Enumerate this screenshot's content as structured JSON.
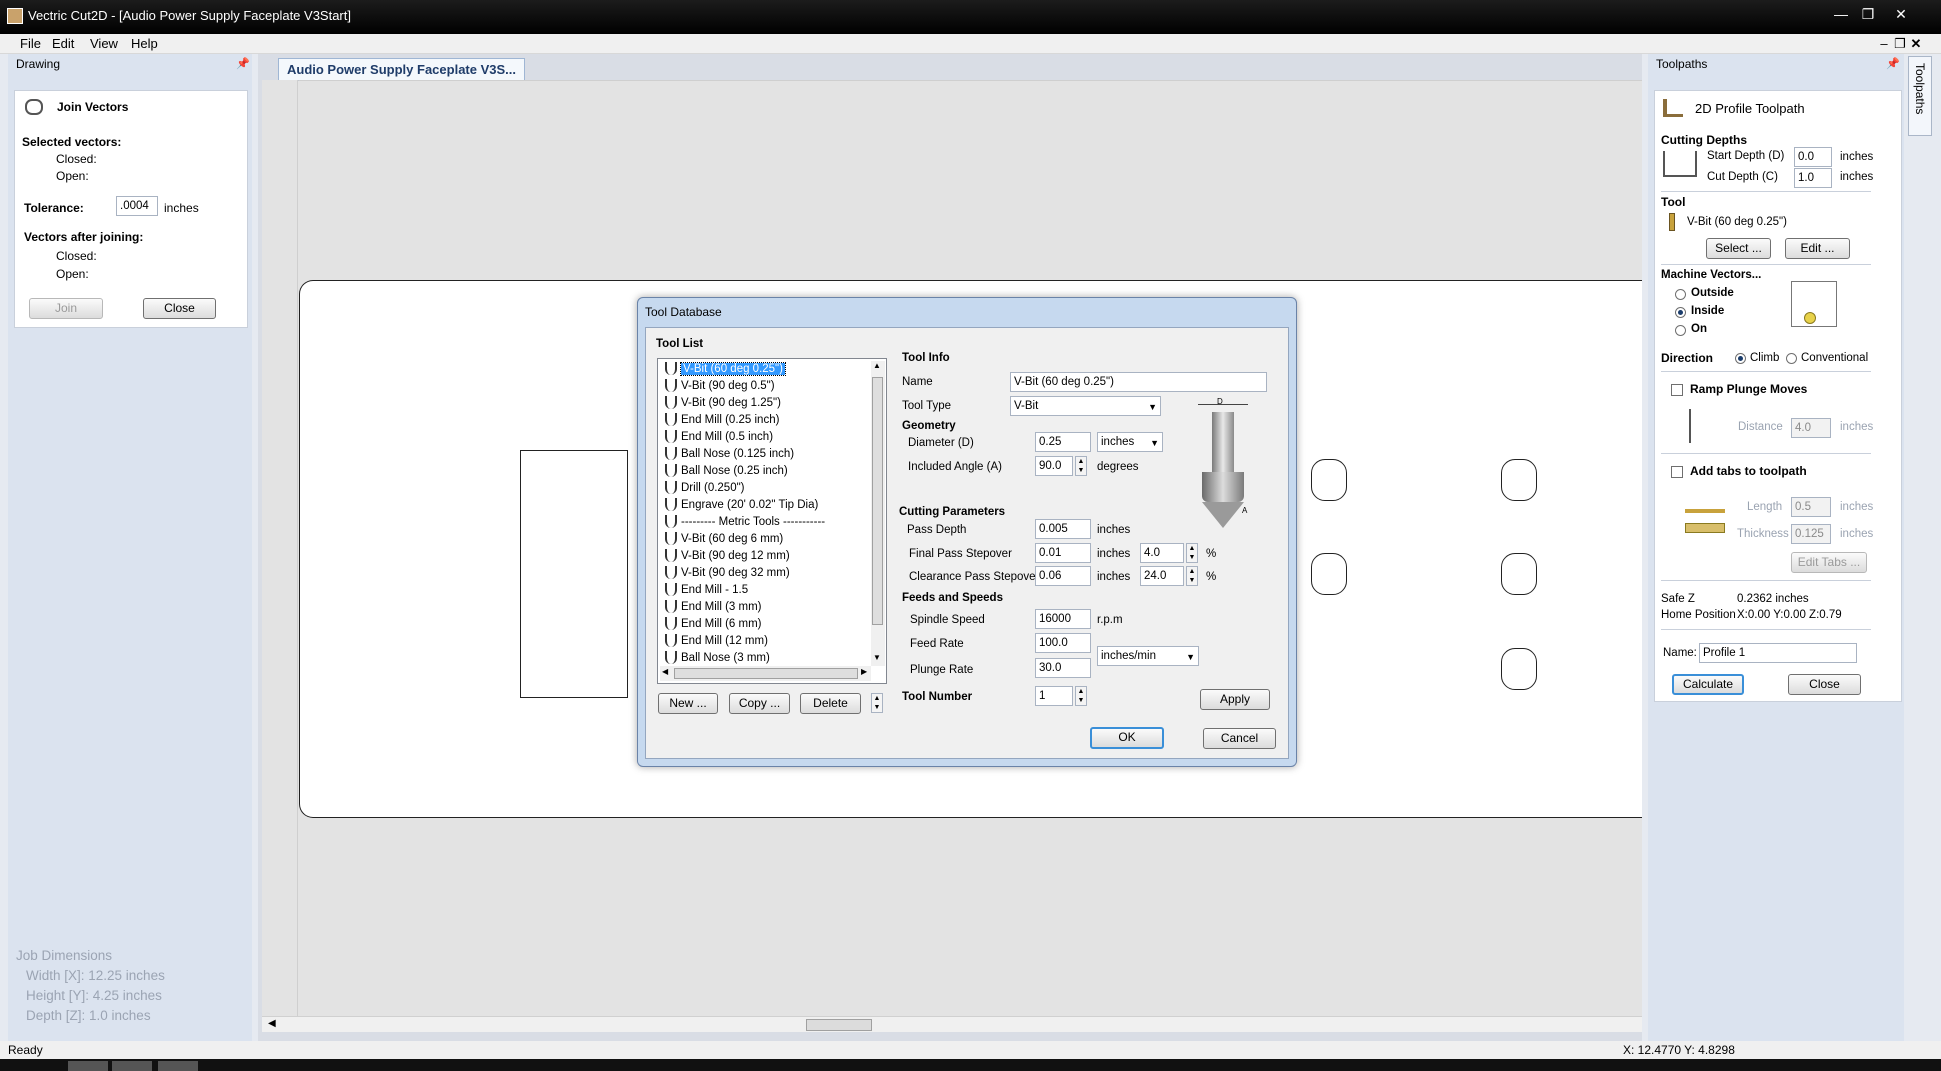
{
  "window": {
    "title": "Vectric Cut2D - [Audio Power Supply Faceplate V3Start]"
  },
  "menu": {
    "file": "File",
    "edit": "Edit",
    "view": "View",
    "help": "Help"
  },
  "left_panel": {
    "header": "Drawing",
    "join_title": "Join Vectors",
    "selected_label": "Selected vectors:",
    "closed_label": "Closed:",
    "open_label": "Open:",
    "tolerance_label": "Tolerance:",
    "tolerance_value": ".0004",
    "tolerance_unit": "inches",
    "after_label": "Vectors after joining:",
    "closed2_label": "Closed:",
    "open2_label": "Open:",
    "join_button": "Join",
    "close_button": "Close"
  },
  "job_dimensions": {
    "title": "Job Dimensions",
    "width": "Width  [X]: 12.25 inches",
    "height": "Height [Y]: 4.25 inches",
    "depth": "Depth  [Z]: 1.0 inches"
  },
  "document_tab": "Audio Power Supply Faceplate V3S...",
  "status": {
    "left": "Ready",
    "coords": "X: 12.4770 Y:  4.8298"
  },
  "toolpaths": {
    "header": "Toolpaths",
    "side_tab": "Toolpaths",
    "title": "2D Profile Toolpath",
    "cutting_depths": "Cutting Depths",
    "start_depth_label": "Start Depth (D)",
    "start_depth_value": "0.0",
    "cut_depth_label": "Cut Depth (C)",
    "cut_depth_value": "1.0",
    "inches": "inches",
    "tool_heading": "Tool",
    "tool_name": "V-Bit (60 deg 0.25\")",
    "select_button": "Select ...",
    "edit_button": "Edit ...",
    "machine_vectors": "Machine Vectors...",
    "outside": "Outside",
    "inside": "Inside",
    "on": "On",
    "direction": "Direction",
    "climb": "Climb",
    "conventional": "Conventional",
    "ramp": "Ramp Plunge Moves",
    "distance_label": "Distance",
    "distance_value": "4.0",
    "add_tabs": "Add tabs to toolpath",
    "length_label": "Length",
    "length_value": "0.5",
    "thickness_label": "Thickness",
    "thickness_value": "0.125",
    "edit_tabs_button": "Edit Tabs ...",
    "safe_z_label": "Safe Z",
    "safe_z_value": "0.2362 inches",
    "home_label": "Home Position",
    "home_value": "X:0.00 Y:0.00 Z:0.79",
    "name_label": "Name:",
    "name_value": "Profile 1",
    "calculate_button": "Calculate",
    "close_button": "Close"
  },
  "dialog": {
    "title": "Tool Database",
    "tool_list_label": "Tool List",
    "tools": [
      "V-Bit (60 deg 0.25\")",
      "V-Bit (90 deg 0.5\")",
      "V-Bit (90 deg 1.25\")",
      "End Mill (0.25 inch)",
      "End Mill (0.5 inch)",
      "Ball Nose (0.125 inch)",
      "Ball Nose (0.25 inch)",
      "Drill (0.250\")",
      "Engrave (20' 0.02\" Tip Dia)",
      "--------- Metric Tools -----------",
      "V-Bit (60 deg 6 mm)",
      "V-Bit (90 deg 12 mm)",
      "V-Bit (90 deg 32 mm)",
      "End Mill - 1.5",
      "End Mill (3 mm)",
      "End Mill (6 mm)",
      "End Mill (12 mm)",
      "Ball Nose (3 mm)"
    ],
    "new_button": "New ...",
    "copy_button": "Copy ...",
    "delete_button": "Delete",
    "tool_info": "Tool Info",
    "name_label": "Name",
    "name_value": "V-Bit (60 deg 0.25\")",
    "tool_type_label": "Tool Type",
    "tool_type_value": "V-Bit",
    "geometry": "Geometry",
    "diameter_label": "Diameter (D)",
    "diameter_value": "0.25",
    "diameter_unit": "inches",
    "angle_label": "Included Angle (A)",
    "angle_value": "90.0",
    "angle_unit": "degrees",
    "cutting_params": "Cutting Parameters",
    "pass_depth_label": "Pass Depth",
    "pass_depth_value": "0.005",
    "final_stepover_label": "Final Pass Stepover",
    "final_stepover_value": "0.01",
    "final_stepover_pct": "4.0",
    "clearance_stepover_label": "Clearance Pass Stepover",
    "clearance_stepover_value": "0.06",
    "clearance_stepover_pct": "24.0",
    "inches": "inches",
    "pct": "%",
    "feeds_speeds": "Feeds and Speeds",
    "spindle_label": "Spindle Speed",
    "spindle_value": "16000",
    "spindle_unit": "r.p.m",
    "feed_label": "Feed Rate",
    "feed_value": "100.0",
    "feed_unit": "inches/min",
    "plunge_label": "Plunge Rate",
    "plunge_value": "30.0",
    "tool_number_label": "Tool Number",
    "tool_number_value": "1",
    "apply_button": "Apply",
    "ok_button": "OK",
    "cancel_button": "Cancel",
    "diagram_d": "D",
    "diagram_a": "A"
  }
}
